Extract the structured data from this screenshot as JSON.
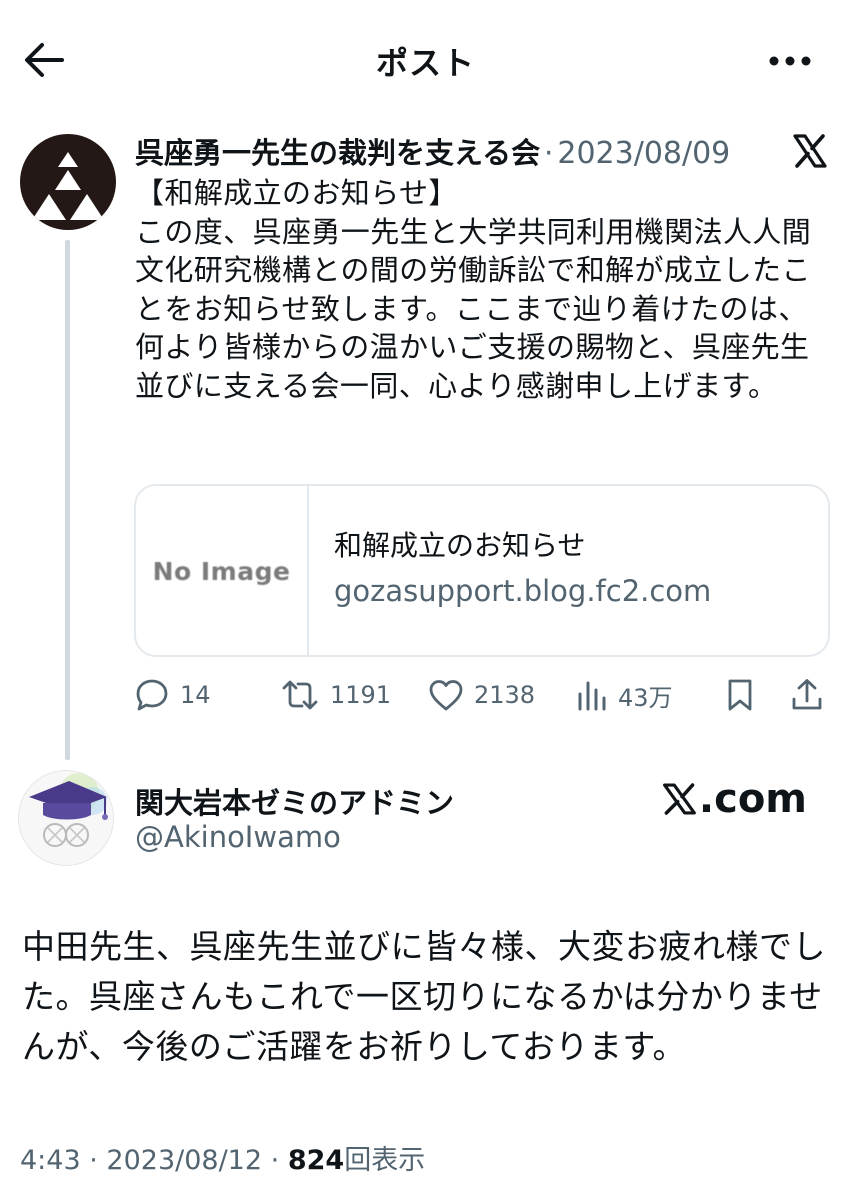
{
  "header": {
    "title": "ポスト",
    "back_icon": "arrow-left-icon",
    "more_icon": "more-horizontal-icon"
  },
  "quoted_post": {
    "author_name": "呉座勇一先生の裁判を支える会",
    "separator": "·",
    "date": "2023/08/09",
    "body": "【和解成立のお知らせ】\nこの度、呉座勇一先生と大学共同利用機関法人人間文化研究機構との間の労働訴訟で和解が成立したことをお知らせ致します。ここまで辿り着けたのは、何より皆様からの温かいご支援の賜物と、呉座先生並びに支える会一同、心より感謝申し上げます。",
    "link_card": {
      "thumbnail_text": "No Image",
      "title": "和解成立のお知らせ",
      "domain": "gozasupport.blog.fc2.com"
    },
    "actions": {
      "replies": "14",
      "reposts": "1191",
      "likes": "2138",
      "views": "43万"
    }
  },
  "reply_post": {
    "author_name": "関大岩本ゼミのアドミン",
    "handle": "@AkinoIwamo",
    "source_label": ".com",
    "body": "中田先生、呉座先生並びに皆々様、大変お疲れ様でした。呉座さんもこれで一区切りになるかは分かりませんが、今後のご活躍をお祈りしております。",
    "time": "4:43",
    "separator": "·",
    "date": "2023/08/12",
    "views_count": "824",
    "views_label": "回表示"
  },
  "colors": {
    "text": "#0f1419",
    "secondary": "#536471",
    "border": "#e4e9ed",
    "thread_line": "#cfd9de"
  }
}
